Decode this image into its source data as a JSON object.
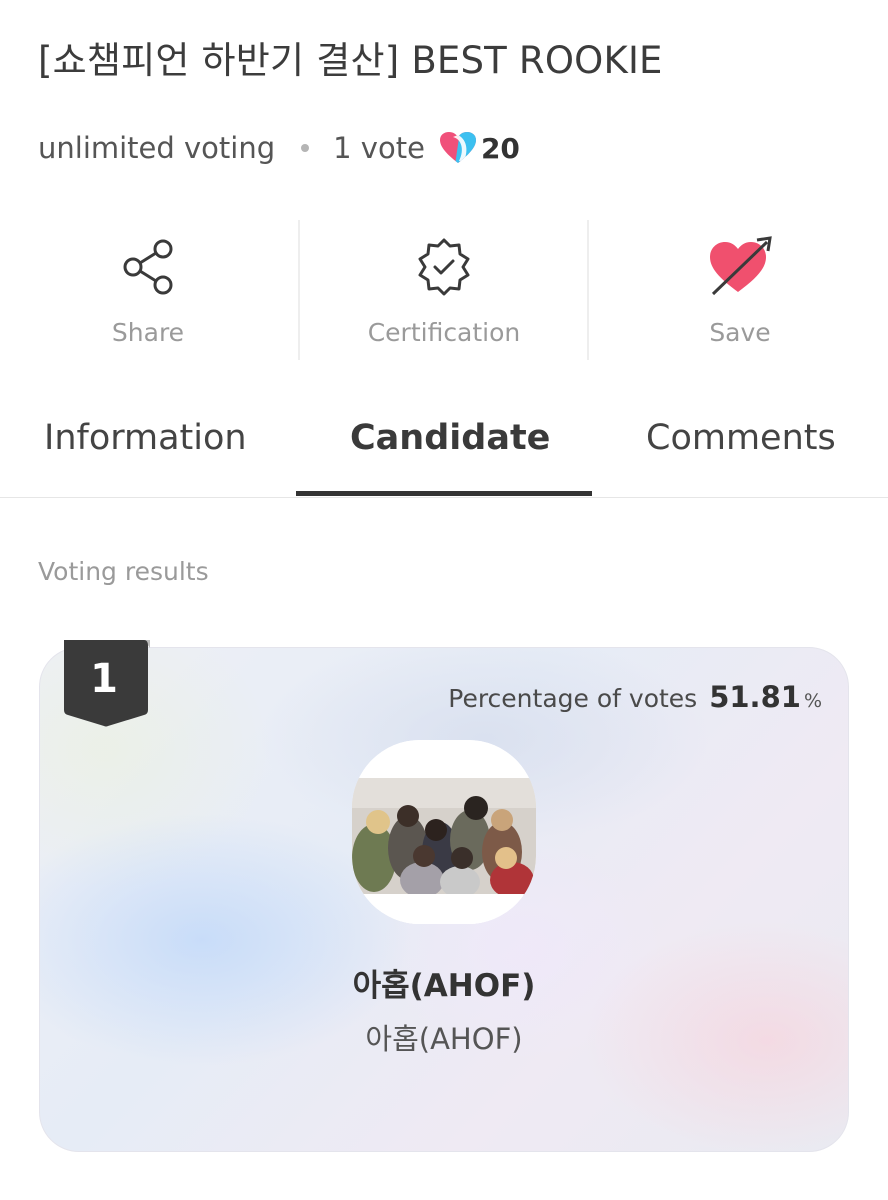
{
  "header": {
    "title": "[쇼챔피언 하반기 결산] BEST ROOKIE",
    "voting_mode": "unlimited voting",
    "vote_cost": "1 vote",
    "heart_count": "20"
  },
  "actions": [
    {
      "label": "Share",
      "icon": "share-icon"
    },
    {
      "label": "Certification",
      "icon": "certification-badge-icon"
    },
    {
      "label": "Save",
      "icon": "heart-arrow-icon"
    }
  ],
  "tabs": [
    {
      "label": "Information",
      "active": false
    },
    {
      "label": "Candidate",
      "active": true
    },
    {
      "label": "Comments",
      "active": false
    }
  ],
  "results": {
    "section_label": "Voting results",
    "candidates": [
      {
        "rank": "1",
        "pct_label": "Percentage of votes",
        "pct_value": "51.81",
        "pct_unit": "%",
        "name": "아홉(AHOF)",
        "subtitle": "아홉(AHOF)"
      }
    ]
  },
  "colors": {
    "heart_pink": "#f0507a",
    "heart_blue": "#3cc0f0",
    "save_heart": "#f0506e",
    "rank_badge": "#3a3a3a"
  }
}
